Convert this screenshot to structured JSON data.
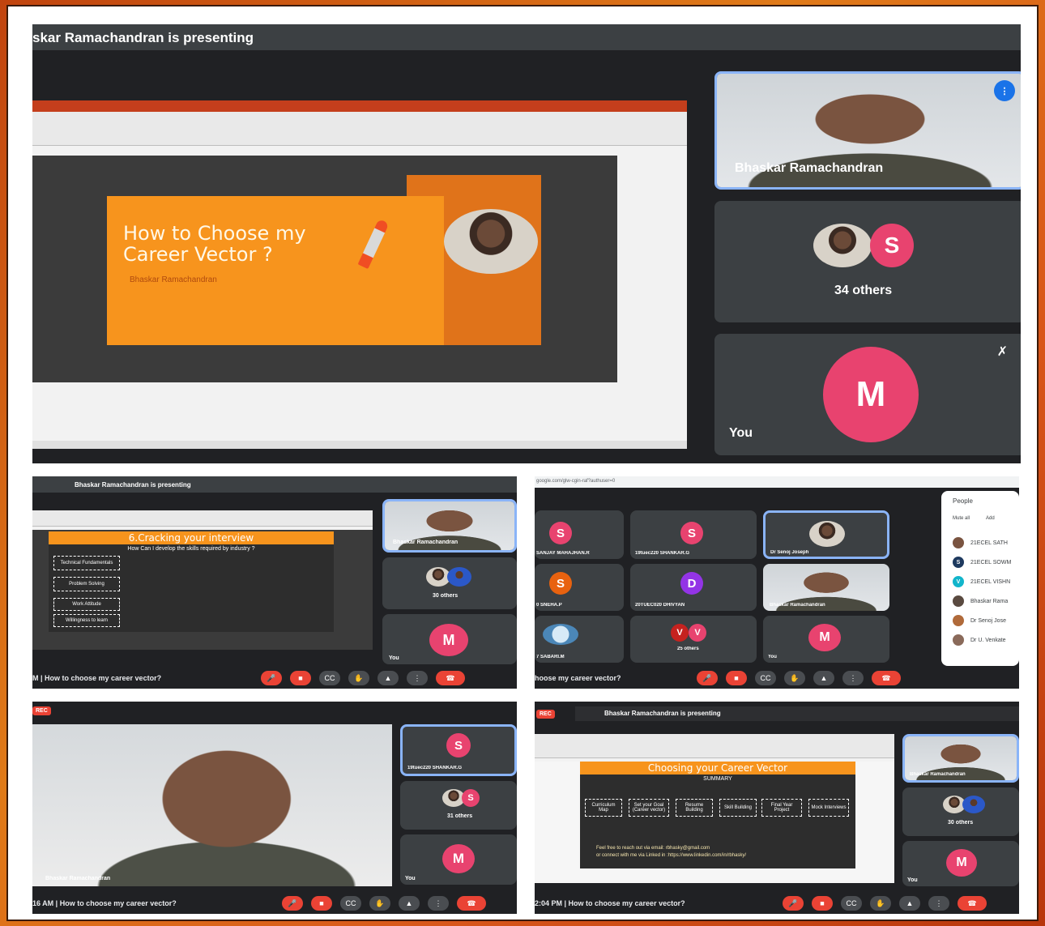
{
  "main": {
    "presenting_banner": "skar Ramachandran is presenting",
    "slide": {
      "title_line1": "How to Choose my",
      "title_line2": "Career Vector ?",
      "author": "Bhaskar Ramachandran"
    },
    "tiles": {
      "presenter_name": "Bhaskar Ramachandran",
      "others_label": "34 others",
      "others_avatar_letter": "S",
      "you_label": "You",
      "you_avatar_letter": "M"
    }
  },
  "shot2": {
    "presenting_banner": "Bhaskar Ramachandran is presenting",
    "slide_title": "6.Cracking your interview",
    "slide_subtitle": "How Can I develop the skills required by industry ?",
    "boxes": [
      "Technical Fundamentals",
      "Problem Solving",
      "Work Attitude",
      "Willingness to learn"
    ],
    "presenter_name": "Bhaskar Ramachandran",
    "others_label": "30 others",
    "you_label": "You",
    "you_avatar_letter": "M",
    "footer": "M  |  How to choose my career vector?"
  },
  "shot3": {
    "url": "google.com/glw-cgin-raf?authuser=0",
    "tiles": [
      {
        "letter": "S",
        "name": "SANJAY MAHAJHAN.R",
        "color": "pink"
      },
      {
        "letter": "S",
        "name": "19tuec220 SHANKAR.G",
        "color": "pink"
      },
      {
        "letter": "",
        "name": "Dr Senoj Joseph",
        "color": "photo"
      },
      {
        "letter": "S",
        "name": "0 SNEHA.P",
        "color": "orange"
      },
      {
        "letter": "D",
        "name": "20TUEC020 DHIVYAN",
        "color": "purple"
      },
      {
        "letter": "",
        "name": "Bhaskar Ramachandran",
        "color": "person"
      },
      {
        "letter": "",
        "name": "7 SABARI.M",
        "color": "logo"
      },
      {
        "letter": "V",
        "name": "25 others",
        "color": "orange"
      },
      {
        "letter": "M",
        "name": "You",
        "color": "pink"
      }
    ],
    "people_title": "People",
    "people_actions": [
      "Mute all",
      "Add"
    ],
    "people_list": [
      "21ECEL SATH",
      "21ECEL SOWM",
      "21ECEL VISHN",
      "Bhaskar Rama",
      "Dr Senoj Jose",
      "Dr U. Venkate"
    ],
    "footer": "hoose my career vector?"
  },
  "shot4": {
    "rec_label": "REC",
    "speaker_name": "Bhaskar Ramachandran",
    "tile1_letter": "S",
    "tile1_name": "19tuec220 SHANKAR.G",
    "others_label": "31 others",
    "you_label": "You",
    "you_avatar_letter": "M",
    "footer": "16 AM  |  How to choose my career vector?"
  },
  "shot5": {
    "rec_label": "REC",
    "presenting_banner": "Bhaskar Ramachandran is presenting",
    "slide_title": "Choosing your Career Vector",
    "slide_subtitle": "SUMMARY",
    "steps": [
      "Curriculum Map",
      "Set your Goal (Career vector)",
      "Resume Building",
      "Skill Building",
      "Final Year Project",
      "Mock Interviews"
    ],
    "contact_line1": "Feel free to reach out via email: rbhasky@gmail.com",
    "contact_line2": "or connect with me via Linked in :https://www.linkedin.com/in/rbhasky/",
    "presenter_name": "Bhaskar Ramachandran",
    "others_label": "30 others",
    "you_label": "You",
    "you_avatar_letter": "M",
    "footer": "2:04 PM  |  How to choose my career vector?"
  },
  "icons": {
    "mic_off": "mic-off-icon",
    "camera_off": "camera-off-icon",
    "captions": "captions-icon",
    "raise_hand": "raise-hand-icon",
    "present": "present-icon",
    "more": "more-options-icon",
    "end_call": "end-call-icon"
  }
}
